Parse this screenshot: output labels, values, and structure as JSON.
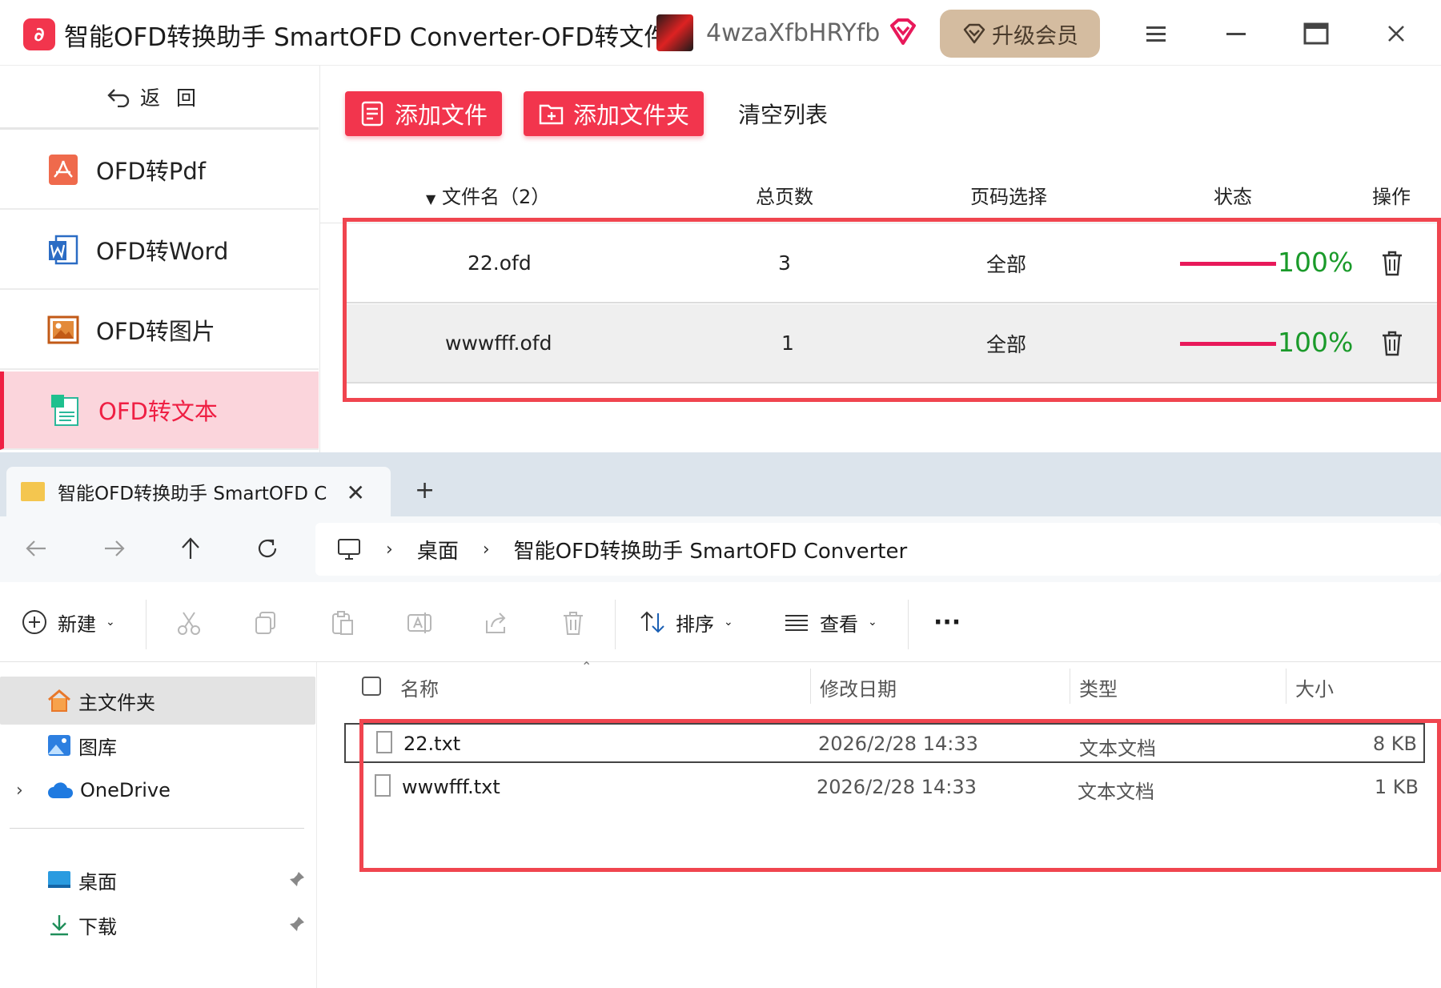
{
  "app": {
    "logo_glyph": "∂",
    "title": "智能OFD转换助手 SmartOFD Converter-OFD转文件",
    "username": "4wzaXfbHRYfb",
    "upgrade_label": "升级会员",
    "accent": "#f2354d",
    "back_label": "返回",
    "nav": [
      {
        "label": "OFD转Pdf",
        "icon": "pdf-icon"
      },
      {
        "label": "OFD转Word",
        "icon": "word-icon"
      },
      {
        "label": "OFD转图片",
        "icon": "image-icon"
      },
      {
        "label": "OFD转文本",
        "icon": "text-icon",
        "active": true
      }
    ],
    "toolbar": {
      "add_file": "添加文件",
      "add_folder": "添加文件夹",
      "clear": "清空列表"
    },
    "table": {
      "headers": {
        "name": "文件名（2）",
        "pages": "总页数",
        "range": "页码选择",
        "status": "状态",
        "action": "操作"
      },
      "rows": [
        {
          "name": "22.ofd",
          "pages": "3",
          "range": "全部",
          "progress": 1.0,
          "pct": "100%"
        },
        {
          "name": "wwwfff.ofd",
          "pages": "1",
          "range": "全部",
          "progress": 1.0,
          "pct": "100%"
        }
      ]
    }
  },
  "explorer": {
    "tab_title": "智能OFD转换助手 SmartOFD C",
    "tab_close": "✕",
    "tab_new": "+",
    "breadcrumb": [
      "桌面",
      "智能OFD转换助手 SmartOFD Converter"
    ],
    "commands": {
      "new": "新建",
      "sort": "排序",
      "view": "查看",
      "more": "···"
    },
    "sidebar": [
      {
        "label": "主文件夹",
        "icon": "home-icon",
        "selected": true
      },
      {
        "label": "图库",
        "icon": "gallery-icon"
      },
      {
        "label": "OneDrive",
        "icon": "cloud-icon"
      },
      {
        "label": "桌面",
        "icon": "desktop-icon",
        "pinned": true
      },
      {
        "label": "下载",
        "icon": "download-icon",
        "pinned": true
      }
    ],
    "columns": {
      "name": "名称",
      "modified": "修改日期",
      "type": "类型",
      "size": "大小"
    },
    "files": [
      {
        "name": "22.txt",
        "modified": "2026/2/28 14:33",
        "type": "文本文档",
        "size": "8 KB"
      },
      {
        "name": "wwwfff.txt",
        "modified": "2026/2/28 14:33",
        "type": "文本文档",
        "size": "1 KB"
      }
    ]
  }
}
